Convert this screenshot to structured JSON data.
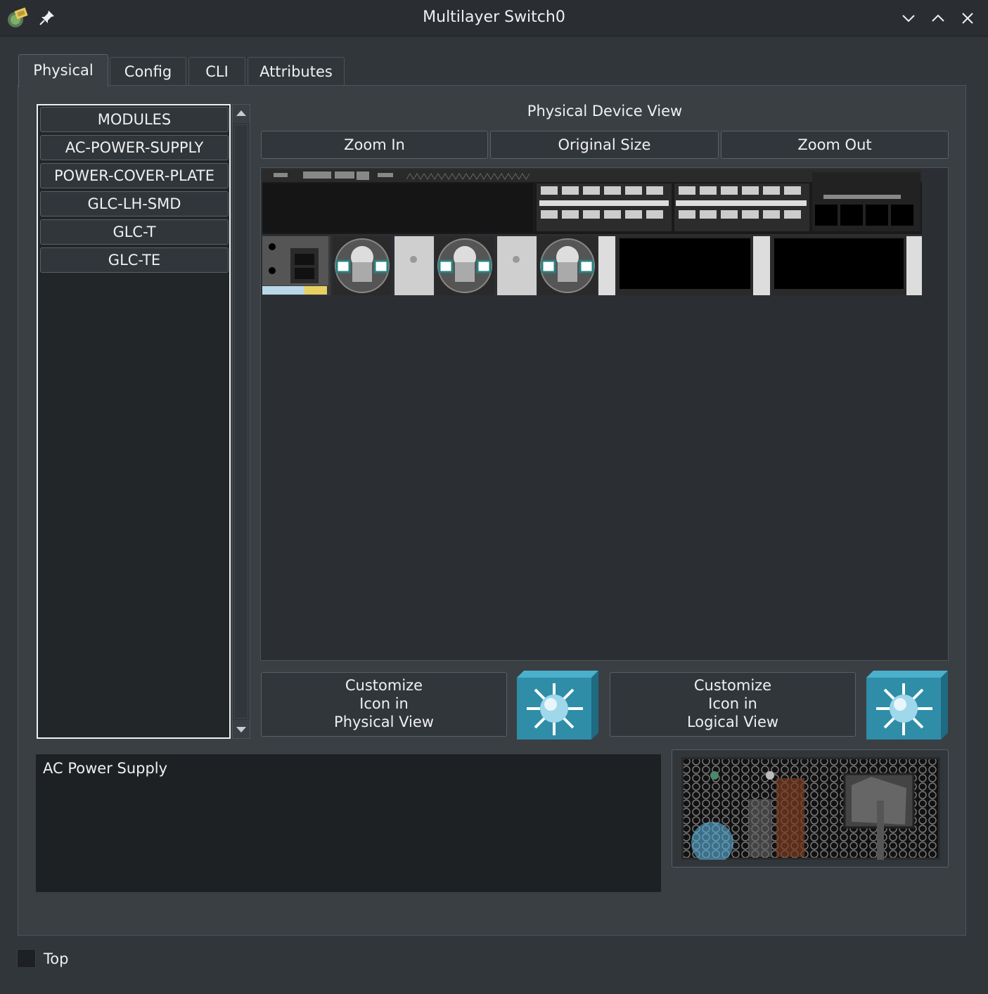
{
  "window": {
    "title": "Multilayer Switch0",
    "app_icon": "packet-tracer-icon",
    "pin_icon": "pin-icon",
    "controls": [
      "minimize-icon",
      "maximize-icon",
      "close-icon"
    ]
  },
  "tabs": [
    {
      "label": "Physical",
      "active": true
    },
    {
      "label": "Config",
      "active": false
    },
    {
      "label": "CLI",
      "active": false
    },
    {
      "label": "Attributes",
      "active": false
    }
  ],
  "modules": {
    "items": [
      "MODULES",
      "AC-POWER-SUPPLY",
      "POWER-COVER-PLATE",
      "GLC-LH-SMD",
      "GLC-T",
      "GLC-TE"
    ]
  },
  "physical_view": {
    "title": "Physical Device View",
    "zoom_in": "Zoom In",
    "original_size": "Original Size",
    "zoom_out": "Zoom Out"
  },
  "customize": {
    "physical": {
      "line1": "Customize",
      "line2": "Icon in",
      "line3": "Physical View"
    },
    "logical": {
      "line1": "Customize",
      "line2": "Icon in",
      "line3": "Logical View"
    },
    "icon": "multilayer-switch-icon"
  },
  "description": "AC Power Supply",
  "top_checkbox": {
    "label": "Top",
    "checked": false
  },
  "colors": {
    "window_bg": "#31363b",
    "panel_bg": "#3a3f44",
    "switch_icon": "#2f8da8"
  }
}
